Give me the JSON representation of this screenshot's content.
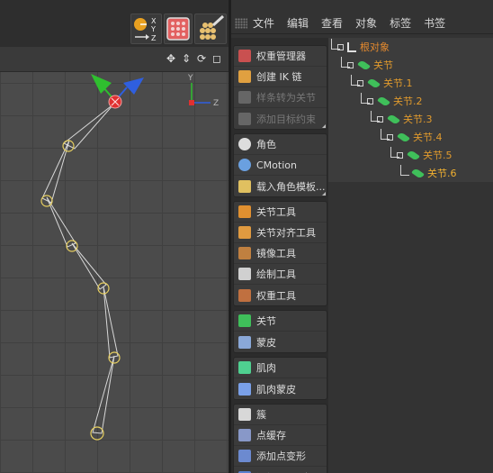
{
  "top_toolbar": {
    "axis_letters": [
      "X",
      "Y",
      "Z"
    ]
  },
  "viewport": {
    "axis_y": "Y",
    "axis_z": "Z",
    "chain_joints": [
      {
        "name": "root"
      },
      {
        "name": "j1"
      },
      {
        "name": "j2"
      },
      {
        "name": "j3"
      },
      {
        "name": "j4"
      },
      {
        "name": "j5"
      },
      {
        "name": "j6"
      },
      {
        "name": "j7"
      }
    ]
  },
  "menubar": {
    "items": [
      "文件",
      "编辑",
      "查看",
      "对象",
      "标签",
      "书签"
    ]
  },
  "tool_groups": [
    [
      {
        "label": "权重管理器",
        "icon": "weight-manager-icon",
        "disabled": false
      },
      {
        "label": "创建 IK 链",
        "icon": "ik-chain-icon",
        "disabled": false
      },
      {
        "label": "样条转为关节",
        "icon": "spline-to-joint-icon",
        "disabled": true
      },
      {
        "label": "添加目标约束",
        "icon": "aim-constraint-icon",
        "disabled": true
      }
    ],
    [
      {
        "label": "角色",
        "icon": "character-icon",
        "disabled": false
      },
      {
        "label": "CMotion",
        "icon": "cmotion-icon",
        "disabled": false
      },
      {
        "label": "载入角色模板...",
        "icon": "character-template-icon",
        "disabled": false
      }
    ],
    [
      {
        "label": "关节工具",
        "icon": "joint-tool-icon",
        "disabled": false
      },
      {
        "label": "关节对齐工具",
        "icon": "joint-align-icon",
        "disabled": false
      },
      {
        "label": "镜像工具",
        "icon": "mirror-tool-icon",
        "disabled": false
      },
      {
        "label": "绘制工具",
        "icon": "paint-tool-icon",
        "disabled": false
      },
      {
        "label": "权重工具",
        "icon": "weight-tool-icon",
        "disabled": false
      }
    ],
    [
      {
        "label": "关节",
        "icon": "joint-icon",
        "disabled": false
      },
      {
        "label": "蒙皮",
        "icon": "skin-icon",
        "disabled": false
      }
    ],
    [
      {
        "label": "肌肉",
        "icon": "muscle-icon",
        "disabled": false
      },
      {
        "label": "肌肉蒙皮",
        "icon": "muscle-skin-icon",
        "disabled": false
      }
    ],
    [
      {
        "label": "簇",
        "icon": "cluster-icon",
        "disabled": false
      },
      {
        "label": "点缓存",
        "icon": "point-cache-icon",
        "disabled": false
      },
      {
        "label": "添加点变形",
        "icon": "point-morph-icon",
        "disabled": false
      },
      {
        "label": "添加 PSR 变形",
        "icon": "psr-morph-icon",
        "disabled": false
      }
    ]
  ],
  "objects": [
    {
      "label": "根对象",
      "depth": 0,
      "kind": "root"
    },
    {
      "label": "关节",
      "depth": 1,
      "kind": "joint"
    },
    {
      "label": "关节.1",
      "depth": 2,
      "kind": "joint"
    },
    {
      "label": "关节.2",
      "depth": 3,
      "kind": "joint"
    },
    {
      "label": "关节.3",
      "depth": 4,
      "kind": "joint"
    },
    {
      "label": "关节.4",
      "depth": 5,
      "kind": "joint"
    },
    {
      "label": "关节.5",
      "depth": 6,
      "kind": "joint"
    },
    {
      "label": "关节.6",
      "depth": 7,
      "kind": "selected"
    }
  ],
  "colors": {
    "root_label": "#e58a2e",
    "joint_label": "#e09a2d",
    "selected_label": "#f0b030",
    "joint_icon": "#3fbf5a",
    "axis_x": "#e03030",
    "axis_y": "#2fbf2f",
    "axis_z": "#2f5fdf",
    "joint_ring": "#e8d060"
  }
}
